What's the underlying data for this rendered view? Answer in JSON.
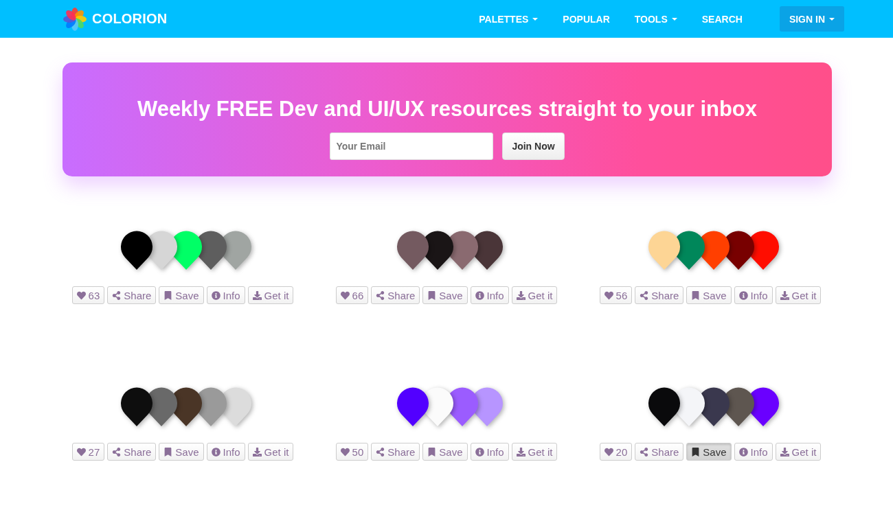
{
  "nav": {
    "brand": "COLORION",
    "items": [
      {
        "label": "PALETTES",
        "dropdown": true
      },
      {
        "label": "POPULAR",
        "dropdown": false
      },
      {
        "label": "TOOLS",
        "dropdown": true
      },
      {
        "label": "SEARCH",
        "dropdown": false
      }
    ],
    "signin": {
      "label": "SIGN IN",
      "dropdown": true
    }
  },
  "banner": {
    "title": "Weekly FREE Dev and UI/UX resources straight to your inbox",
    "email": {
      "placeholder": "Your Email"
    },
    "button": "Join Now"
  },
  "palettes": [
    {
      "colors": [
        {
          "color": "#000000"
        },
        {
          "color": "#d6d6d6"
        },
        {
          "color": "#00ff66"
        },
        {
          "color": "#5e5e5e"
        },
        {
          "color": "#a0a5a2"
        }
      ],
      "likes": "63",
      "actions": {
        "share": "Share",
        "save": "Save",
        "info": "Info",
        "get": "Get it"
      },
      "saved": false
    },
    {
      "colors": [
        {
          "color": "#745a60"
        },
        {
          "color": "#1a1516"
        },
        {
          "color": "#8a6a70"
        },
        {
          "color": "#4a3538"
        }
      ],
      "likes": "66",
      "actions": {
        "share": "Share",
        "save": "Save",
        "info": "Info",
        "get": "Get it"
      },
      "saved": false
    },
    {
      "colors": [
        {
          "color": "#fdd595"
        },
        {
          "color": "#00875a"
        },
        {
          "color": "#ff3f00"
        },
        {
          "color": "#780000"
        },
        {
          "color": "#ff0d00"
        }
      ],
      "likes": "56",
      "actions": {
        "share": "Share",
        "save": "Save",
        "info": "Info",
        "get": "Get it"
      },
      "saved": false
    },
    {
      "colors": [
        {
          "color": "#0e0e0e"
        },
        {
          "color": "#696969"
        },
        {
          "color": "#4a3526"
        },
        {
          "color": "#9a9a9a"
        },
        {
          "color": "#dcdcdc"
        }
      ],
      "likes": "27",
      "actions": {
        "share": "Share",
        "save": "Save",
        "info": "Info",
        "get": "Get it"
      },
      "saved": false
    },
    {
      "colors": [
        {
          "color": "#5200ff"
        },
        {
          "color": "#fbfbfb"
        },
        {
          "color": "#9b5cff"
        },
        {
          "color": "#b795ff"
        }
      ],
      "likes": "50",
      "actions": {
        "share": "Share",
        "save": "Save",
        "info": "Info",
        "get": "Get it"
      },
      "saved": false
    },
    {
      "colors": [
        {
          "color": "#0a0a0c"
        },
        {
          "color": "#f4f5f8"
        },
        {
          "color": "#3a384e"
        },
        {
          "color": "#5e5650"
        },
        {
          "color": "#6a00ff"
        }
      ],
      "likes": "20",
      "actions": {
        "share": "Share",
        "save": "Save",
        "info": "Info",
        "get": "Get it"
      },
      "saved": true
    }
  ]
}
